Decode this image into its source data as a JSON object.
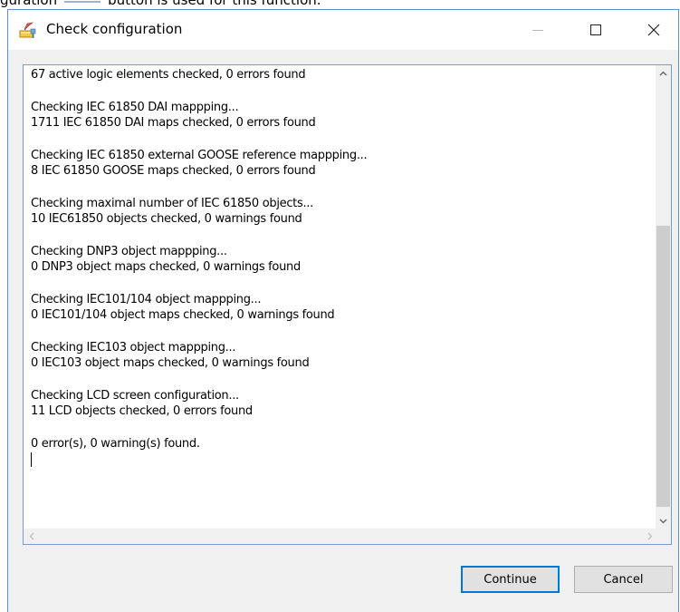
{
  "background": {
    "partial_text_left": "guration",
    "partial_text_right": "button is used for this function."
  },
  "window": {
    "title": "Check configuration",
    "icon": "check-configuration-icon",
    "controls": {
      "minimize": "minimize-icon",
      "maximize": "maximize-icon",
      "close": "close-icon"
    }
  },
  "log": {
    "blocks": [
      {
        "lines": [
          "67 active logic elements checked, 0 errors found"
        ]
      },
      {
        "lines": [
          "Checking IEC 61850 DAI mappping...",
          "1711 IEC 61850 DAI maps checked, 0 errors found"
        ]
      },
      {
        "lines": [
          "Checking IEC 61850 external GOOSE reference mappping...",
          "8 IEC 61850 GOOSE maps checked, 0 errors found"
        ]
      },
      {
        "lines": [
          "Checking maximal number of IEC 61850 objects...",
          "10 IEC61850 objects checked, 0 warnings found"
        ]
      },
      {
        "lines": [
          "Checking DNP3 object mappping...",
          "0 DNP3 object maps checked, 0 warnings found"
        ]
      },
      {
        "lines": [
          "Checking IEC101/104 object mappping...",
          "0 IEC101/104 object maps checked, 0 warnings found"
        ]
      },
      {
        "lines": [
          "Checking IEC103 object mappping...",
          "0 IEC103 object maps checked, 0 warnings found"
        ]
      },
      {
        "lines": [
          "Checking LCD screen configuration...",
          "11 LCD objects checked, 0 errors found"
        ]
      },
      {
        "lines": [
          "0 error(s), 0 warning(s) found."
        ]
      }
    ]
  },
  "buttons": {
    "continue_label": "Continue",
    "cancel_label": "Cancel"
  },
  "colors": {
    "window_border": "#5b8fd0",
    "default_button_border": "#0078d7",
    "dialog_background": "#f0f0f0"
  }
}
